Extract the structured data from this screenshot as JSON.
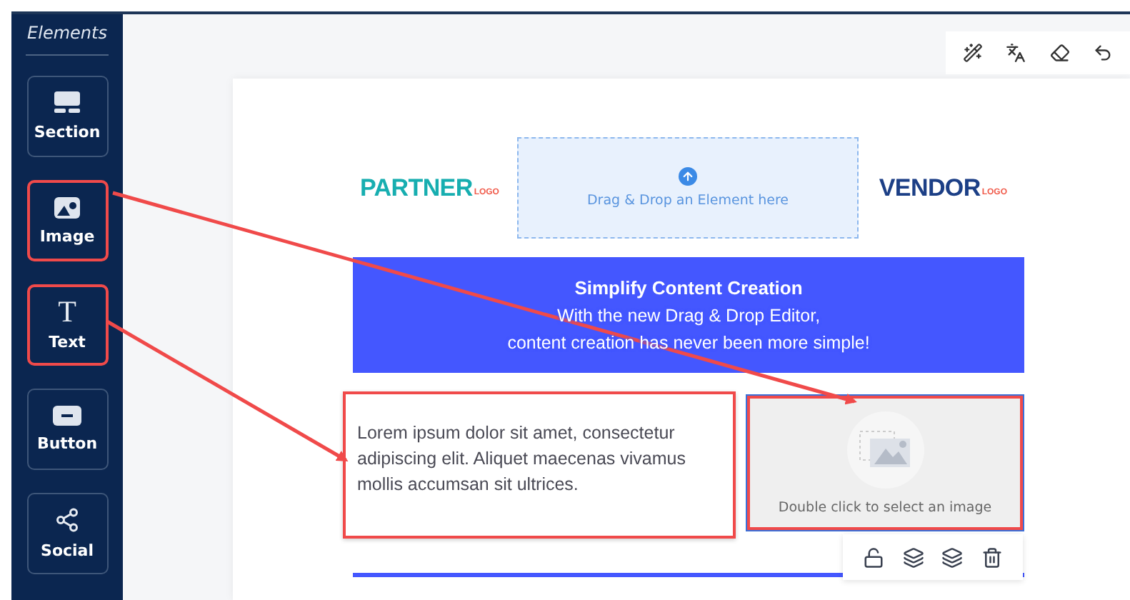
{
  "sidebar": {
    "title": "Elements",
    "items": [
      {
        "label": "Section",
        "kind": "section",
        "highlighted": false
      },
      {
        "label": "Image",
        "kind": "image",
        "highlighted": true
      },
      {
        "label": "Text",
        "kind": "text",
        "glyph": "T",
        "highlighted": true
      },
      {
        "label": "Button",
        "kind": "button",
        "highlighted": false
      },
      {
        "label": "Social",
        "kind": "social",
        "highlighted": false
      }
    ]
  },
  "header": {
    "partner_logo": {
      "name": "PARTNER",
      "tag": "LOGO"
    },
    "dropzone": {
      "text": "Drag & Drop an Element here"
    },
    "vendor_logo": {
      "name": "VENDOR",
      "tag": "LOGO"
    }
  },
  "banner": {
    "title": "Simplify Content Creation",
    "lines": [
      "With the new Drag & Drop Editor,",
      "content creation has never been more simple!"
    ]
  },
  "text_block": {
    "text": "Lorem ipsum dolor sit amet, consectetur adipiscing elit. Aliquet maecenas vivamus mollis accumsan sit ultrices.",
    "highlighted": true
  },
  "image_block": {
    "placeholder": "Double click to select an image",
    "highlighted": true,
    "selected": true
  }
}
